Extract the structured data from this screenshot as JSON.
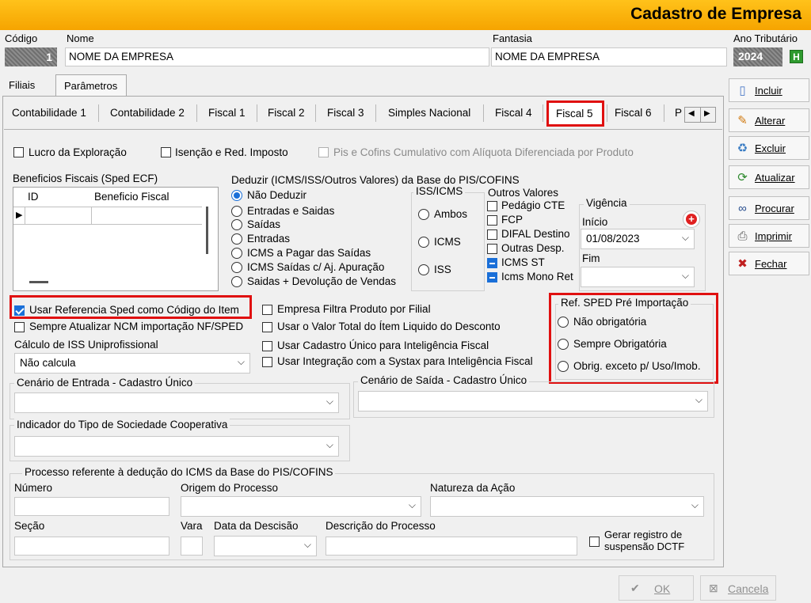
{
  "window": {
    "title": "Cadastro de Empresa"
  },
  "header": {
    "codigo_label": "Código",
    "codigo_value": "1",
    "nome_label": "Nome",
    "nome_value": "NOME DA EMPRESA",
    "fantasia_label": "Fantasia",
    "fantasia_value": "NOME DA EMPRESA",
    "ano_label": "Ano Tributário",
    "ano_value": "2024",
    "ano_button": "H"
  },
  "top_tabs": [
    "Filiais",
    "Parâmetros"
  ],
  "tabs": [
    {
      "label": "Contabilidade 1"
    },
    {
      "label": "Contabilidade 2"
    },
    {
      "label": "Fiscal 1"
    },
    {
      "label": "Fiscal 2"
    },
    {
      "label": "Fiscal 3"
    },
    {
      "label": "Simples Nacional"
    },
    {
      "label": "Fiscal 4"
    },
    {
      "label": "Fiscal 5"
    },
    {
      "label": "Fiscal 6"
    },
    {
      "label": "P"
    }
  ],
  "top_checks": {
    "lucro": "Lucro da Exploração",
    "isencao": "Isenção e Red. Imposto",
    "pis_cofins": "Pis e Cofins Cumulativo com Alíquota Diferenciada por Produto"
  },
  "beneficios": {
    "title": "Beneficios Fiscais (Sped ECF)",
    "col_id": "ID",
    "col_beneficio": "Beneficio Fiscal"
  },
  "deduzir": {
    "title": "Deduzir (ICMS/ISS/Outros Valores)  da Base do PIS/COFINS",
    "options": [
      "Não Deduzir",
      "Entradas e Saidas",
      "Saídas",
      "Entradas",
      "ICMS a Pagar das Saídas",
      "ICMS Saídas c/ Aj. Apuração",
      "Saidas +  Devolução de Vendas"
    ],
    "selected_index": 0
  },
  "iss_icms": {
    "title": "ISS/ICMS",
    "options": [
      "Ambos",
      "ICMS",
      "ISS"
    ]
  },
  "outros_valores": {
    "title": "Outros Valores",
    "items": [
      {
        "label": "Pedágio CTE",
        "state": "unchecked"
      },
      {
        "label": "FCP",
        "state": "unchecked"
      },
      {
        "label": "DIFAL Destino",
        "state": "unchecked"
      },
      {
        "label": "Outras Desp.",
        "state": "unchecked"
      },
      {
        "label": "ICMS ST",
        "state": "indeterminate"
      },
      {
        "label": "Icms Mono Ret",
        "state": "indeterminate"
      }
    ]
  },
  "vigencia": {
    "title": "Vigência",
    "inicio_label": "Início",
    "inicio_value": "01/08/2023",
    "fim_label": "Fim",
    "fim_value": ""
  },
  "options_left": {
    "usar_ref_sped": "Usar Referencia Sped como Código do Item",
    "sempre_atualizar": "Sempre Atualizar NCM importação NF/SPED",
    "calculo_iss_label": "Cálculo de ISS Uniprofissional",
    "calculo_iss_value": "Não calcula"
  },
  "options_mid": {
    "empresa_filtra": "Empresa Filtra Produto por Filial",
    "valor_total": "Usar o Valor Total do Ítem Liquido do Desconto",
    "cadastro_unico": "Usar Cadastro Único para Inteligência Fiscal",
    "systax": "Usar Integração com a Systax para Inteligência Fiscal"
  },
  "ref_sped": {
    "title": "Ref. SPED Pré Importação",
    "options": [
      "Não obrigatória",
      "Sempre Obrigatória",
      "Obrig. exceto p/ Uso/Imob."
    ]
  },
  "cenarios": {
    "entrada": "Cenário de Entrada - Cadastro Único",
    "saida": "Cenário de Saída - Cadastro Único",
    "cooperativa": "Indicador do Tipo de Sociedade Cooperativa"
  },
  "processo": {
    "title": "Processo referente à dedução do ICMS da Base do PIS/COFINS",
    "numero": "Número",
    "origem": "Origem do Processo",
    "natureza": "Natureza da Ação",
    "secao": "Seção",
    "vara": "Vara",
    "data": "Data da Descisão",
    "descricao": "Descrição do Processo",
    "gerar_registro": "Gerar registro de suspensão DCTF"
  },
  "side_buttons": [
    {
      "label": "Incluir",
      "icon": "document-icon"
    },
    {
      "label": "Alterar",
      "icon": "edit-icon"
    },
    {
      "label": "Excluir",
      "icon": "trash-icon"
    },
    {
      "label": "Atualizar",
      "icon": "refresh-icon"
    },
    {
      "label": "Procurar",
      "icon": "binoculars-icon"
    },
    {
      "label": "Imprimir",
      "icon": "printer-icon"
    },
    {
      "label": "Fechar",
      "icon": "close-window-icon"
    }
  ],
  "footer": {
    "ok": "OK",
    "cancela": "Cancela"
  },
  "colors": {
    "title_bar": "#f6a400",
    "highlight": "#e01010",
    "accent": "#1a6fd8"
  }
}
